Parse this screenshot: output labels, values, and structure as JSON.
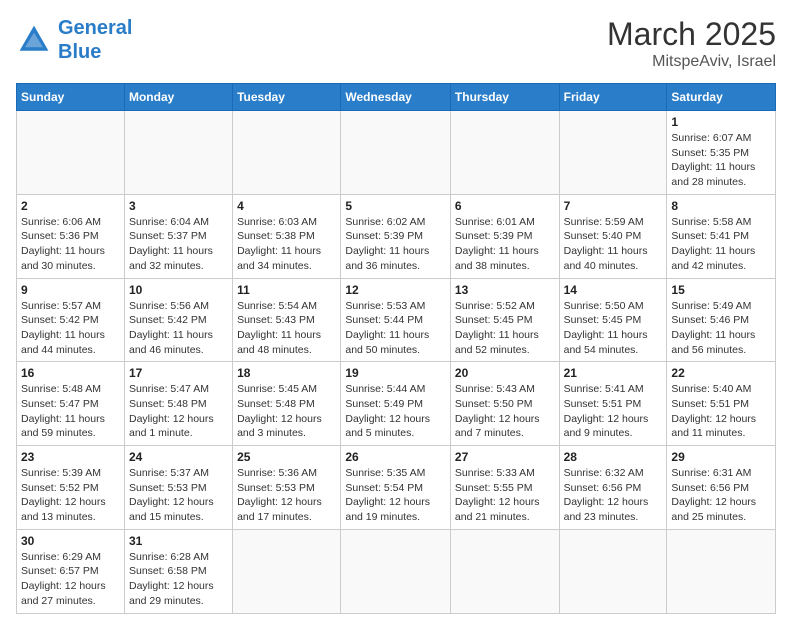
{
  "header": {
    "logo_general": "General",
    "logo_blue": "Blue",
    "month_title": "March 2025",
    "location": "MitspeAviv, Israel"
  },
  "weekdays": [
    "Sunday",
    "Monday",
    "Tuesday",
    "Wednesday",
    "Thursday",
    "Friday",
    "Saturday"
  ],
  "weeks": [
    [
      {
        "day": "",
        "info": ""
      },
      {
        "day": "",
        "info": ""
      },
      {
        "day": "",
        "info": ""
      },
      {
        "day": "",
        "info": ""
      },
      {
        "day": "",
        "info": ""
      },
      {
        "day": "",
        "info": ""
      },
      {
        "day": "1",
        "info": "Sunrise: 6:07 AM\nSunset: 5:35 PM\nDaylight: 11 hours\nand 28 minutes."
      }
    ],
    [
      {
        "day": "2",
        "info": "Sunrise: 6:06 AM\nSunset: 5:36 PM\nDaylight: 11 hours\nand 30 minutes."
      },
      {
        "day": "3",
        "info": "Sunrise: 6:04 AM\nSunset: 5:37 PM\nDaylight: 11 hours\nand 32 minutes."
      },
      {
        "day": "4",
        "info": "Sunrise: 6:03 AM\nSunset: 5:38 PM\nDaylight: 11 hours\nand 34 minutes."
      },
      {
        "day": "5",
        "info": "Sunrise: 6:02 AM\nSunset: 5:39 PM\nDaylight: 11 hours\nand 36 minutes."
      },
      {
        "day": "6",
        "info": "Sunrise: 6:01 AM\nSunset: 5:39 PM\nDaylight: 11 hours\nand 38 minutes."
      },
      {
        "day": "7",
        "info": "Sunrise: 5:59 AM\nSunset: 5:40 PM\nDaylight: 11 hours\nand 40 minutes."
      },
      {
        "day": "8",
        "info": "Sunrise: 5:58 AM\nSunset: 5:41 PM\nDaylight: 11 hours\nand 42 minutes."
      }
    ],
    [
      {
        "day": "9",
        "info": "Sunrise: 5:57 AM\nSunset: 5:42 PM\nDaylight: 11 hours\nand 44 minutes."
      },
      {
        "day": "10",
        "info": "Sunrise: 5:56 AM\nSunset: 5:42 PM\nDaylight: 11 hours\nand 46 minutes."
      },
      {
        "day": "11",
        "info": "Sunrise: 5:54 AM\nSunset: 5:43 PM\nDaylight: 11 hours\nand 48 minutes."
      },
      {
        "day": "12",
        "info": "Sunrise: 5:53 AM\nSunset: 5:44 PM\nDaylight: 11 hours\nand 50 minutes."
      },
      {
        "day": "13",
        "info": "Sunrise: 5:52 AM\nSunset: 5:45 PM\nDaylight: 11 hours\nand 52 minutes."
      },
      {
        "day": "14",
        "info": "Sunrise: 5:50 AM\nSunset: 5:45 PM\nDaylight: 11 hours\nand 54 minutes."
      },
      {
        "day": "15",
        "info": "Sunrise: 5:49 AM\nSunset: 5:46 PM\nDaylight: 11 hours\nand 56 minutes."
      }
    ],
    [
      {
        "day": "16",
        "info": "Sunrise: 5:48 AM\nSunset: 5:47 PM\nDaylight: 11 hours\nand 59 minutes."
      },
      {
        "day": "17",
        "info": "Sunrise: 5:47 AM\nSunset: 5:48 PM\nDaylight: 12 hours\nand 1 minute."
      },
      {
        "day": "18",
        "info": "Sunrise: 5:45 AM\nSunset: 5:48 PM\nDaylight: 12 hours\nand 3 minutes."
      },
      {
        "day": "19",
        "info": "Sunrise: 5:44 AM\nSunset: 5:49 PM\nDaylight: 12 hours\nand 5 minutes."
      },
      {
        "day": "20",
        "info": "Sunrise: 5:43 AM\nSunset: 5:50 PM\nDaylight: 12 hours\nand 7 minutes."
      },
      {
        "day": "21",
        "info": "Sunrise: 5:41 AM\nSunset: 5:51 PM\nDaylight: 12 hours\nand 9 minutes."
      },
      {
        "day": "22",
        "info": "Sunrise: 5:40 AM\nSunset: 5:51 PM\nDaylight: 12 hours\nand 11 minutes."
      }
    ],
    [
      {
        "day": "23",
        "info": "Sunrise: 5:39 AM\nSunset: 5:52 PM\nDaylight: 12 hours\nand 13 minutes."
      },
      {
        "day": "24",
        "info": "Sunrise: 5:37 AM\nSunset: 5:53 PM\nDaylight: 12 hours\nand 15 minutes."
      },
      {
        "day": "25",
        "info": "Sunrise: 5:36 AM\nSunset: 5:53 PM\nDaylight: 12 hours\nand 17 minutes."
      },
      {
        "day": "26",
        "info": "Sunrise: 5:35 AM\nSunset: 5:54 PM\nDaylight: 12 hours\nand 19 minutes."
      },
      {
        "day": "27",
        "info": "Sunrise: 5:33 AM\nSunset: 5:55 PM\nDaylight: 12 hours\nand 21 minutes."
      },
      {
        "day": "28",
        "info": "Sunrise: 6:32 AM\nSunset: 6:56 PM\nDaylight: 12 hours\nand 23 minutes."
      },
      {
        "day": "29",
        "info": "Sunrise: 6:31 AM\nSunset: 6:56 PM\nDaylight: 12 hours\nand 25 minutes."
      }
    ],
    [
      {
        "day": "30",
        "info": "Sunrise: 6:29 AM\nSunset: 6:57 PM\nDaylight: 12 hours\nand 27 minutes."
      },
      {
        "day": "31",
        "info": "Sunrise: 6:28 AM\nSunset: 6:58 PM\nDaylight: 12 hours\nand 29 minutes."
      },
      {
        "day": "",
        "info": ""
      },
      {
        "day": "",
        "info": ""
      },
      {
        "day": "",
        "info": ""
      },
      {
        "day": "",
        "info": ""
      },
      {
        "day": "",
        "info": ""
      }
    ]
  ]
}
